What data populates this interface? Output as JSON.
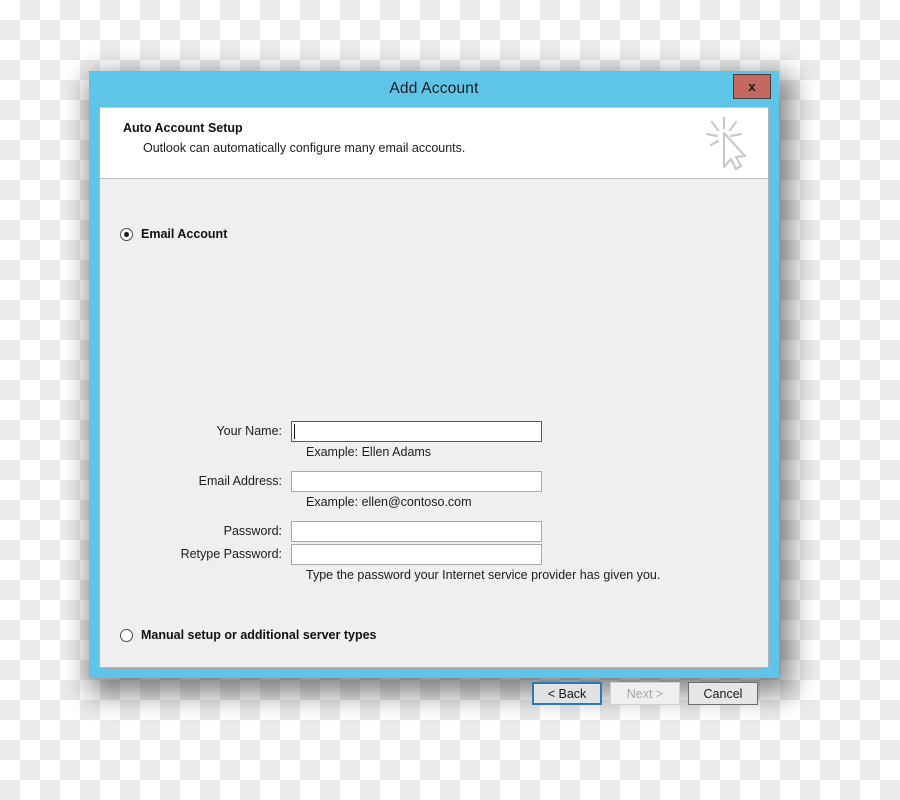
{
  "window": {
    "title": "Add Account",
    "close_label": "x",
    "accent_color": "#5fc5e8",
    "close_button_color": "#c4695f"
  },
  "header": {
    "heading": "Auto Account Setup",
    "subtext": "Outlook can automatically configure many email accounts.",
    "icon": "mouse-pointer-click-icon"
  },
  "options": {
    "email_account": {
      "label": "Email Account",
      "selected": true
    },
    "manual_setup": {
      "label": "Manual setup or additional server types",
      "selected": false
    }
  },
  "form": {
    "fields": [
      {
        "name": "your-name",
        "label": "Your Name:",
        "value": "",
        "hint": "Example: Ellen Adams",
        "focused": true
      },
      {
        "name": "email-address",
        "label": "Email Address:",
        "value": "",
        "hint": "Example: ellen@contoso.com",
        "focused": false
      },
      {
        "name": "password",
        "label": "Password:",
        "value": "",
        "focused": false
      },
      {
        "name": "retype-password",
        "label": "Retype Password:",
        "value": "",
        "focused": false
      }
    ],
    "password_hint": "Type the password your Internet service provider has given you."
  },
  "footer": {
    "back_label": "< Back",
    "next_label": "Next >",
    "cancel_label": "Cancel",
    "next_disabled": true,
    "back_is_default": true,
    "focus_color": "#2a7ab8"
  }
}
